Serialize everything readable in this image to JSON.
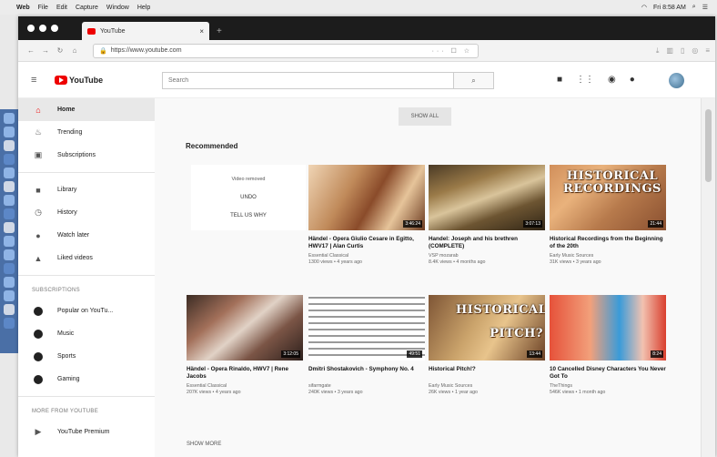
{
  "menubar": {
    "items": [
      "Web",
      "File",
      "Edit",
      "Capture",
      "Window",
      "Help"
    ],
    "clock": "Fri 8:58 AM"
  },
  "browser": {
    "tab_title": "YouTube",
    "url": "https://www.youtube.com"
  },
  "youtube": {
    "logo_text": "YouTube",
    "search_placeholder": "Search",
    "sidebar": {
      "main": [
        "Home",
        "Trending",
        "Subscriptions"
      ],
      "library": [
        "Library",
        "History",
        "Watch later",
        "Liked videos"
      ],
      "subscriptions_header": "SUBSCRIPTIONS",
      "subscriptions": [
        "Popular on YouTu...",
        "Music",
        "Sports",
        "Gaming"
      ],
      "more_header": "MORE FROM YOUTUBE",
      "more": [
        "YouTube Premium"
      ]
    },
    "show_all": "SHOW ALL",
    "recommended": "Recommended",
    "removed": {
      "text": "Video removed",
      "undo": "UNDO",
      "tell": "TELL US WHY"
    },
    "videos": [
      {
        "title": "Händel - Opera Giulio Cesare in Egitto, HWV17 | Alan Curtis",
        "channel": "Essential Classical",
        "meta": "1300 views • 4 years ago",
        "duration": "3:46:24",
        "overlay": ""
      },
      {
        "title": "Handel: Joseph and his brethren (COMPLETE)",
        "channel": "VSP mozarab",
        "meta": "8.4K views • 4 months ago",
        "duration": "3:07:13",
        "overlay": ""
      },
      {
        "title": "Historical Recordings from the Beginning of the 20th",
        "channel": "Early Music Sources",
        "meta": "31K views • 3 years ago",
        "duration": "21:44",
        "overlay": "HISTORICAL RECORDINGS"
      },
      {
        "title": "Händel - Opera Rinaldo, HWV7 | Rene Jacobs",
        "channel": "Essential Classical",
        "meta": "207K views • 4 years ago",
        "duration": "3:12:05",
        "overlay": ""
      },
      {
        "title": "Dmitri Shostakovich - Symphony No. 4",
        "channel": "sifarmgate",
        "meta": "240K views • 3 years ago",
        "duration": "49:51",
        "overlay": ""
      },
      {
        "title": "Historical Pitch!?",
        "channel": "Early Music Sources",
        "meta": "26K views • 1 year ago",
        "duration": "13:44",
        "overlay": "HISTORICAL PITCH?"
      },
      {
        "title": "10 Cancelled Disney Characters You Never Got To",
        "channel": "TheThings",
        "meta": "546K views • 1 month ago",
        "duration": "8:24",
        "overlay": ""
      }
    ],
    "show_more": "SHOW MORE"
  }
}
